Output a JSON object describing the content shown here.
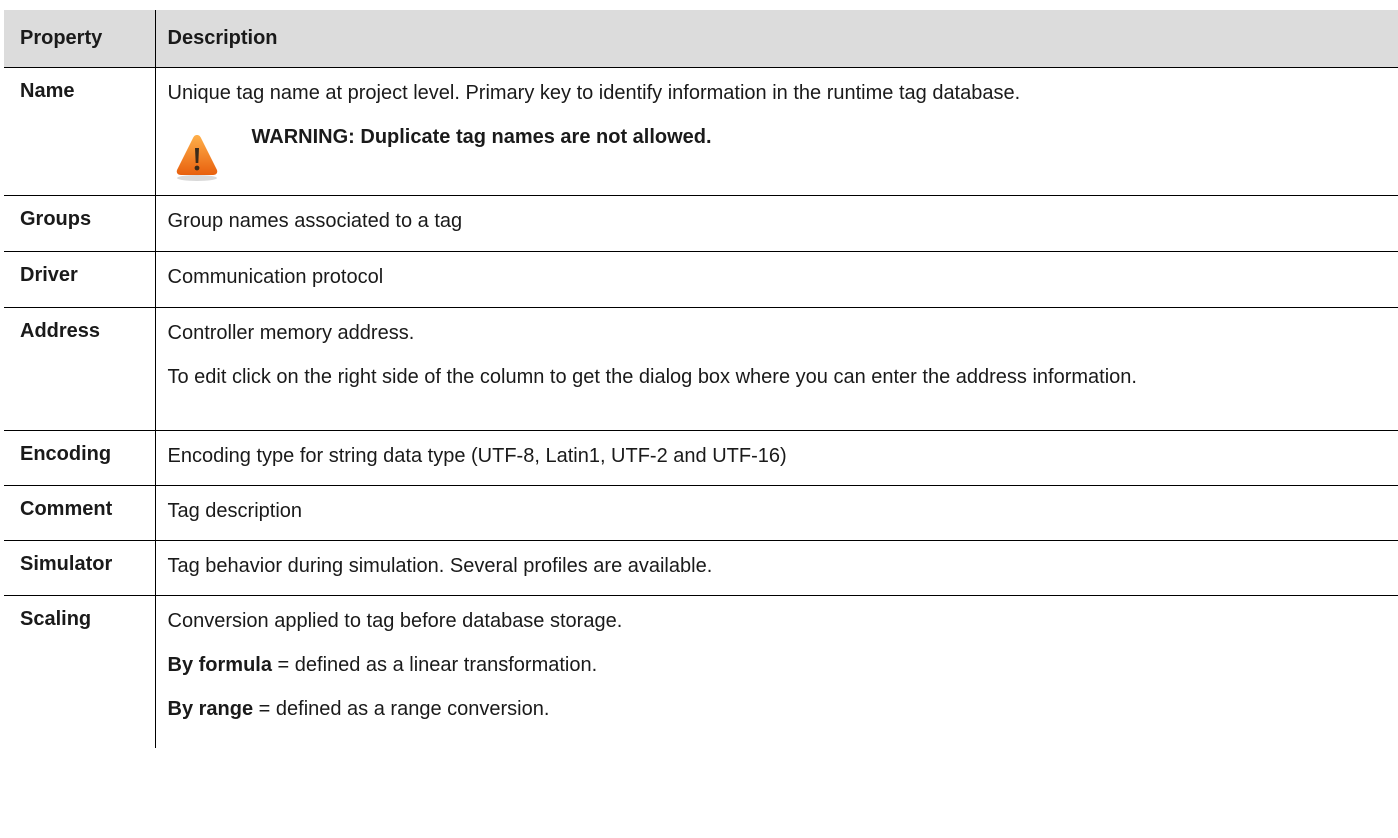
{
  "table": {
    "headers": {
      "property": "Property",
      "description": "Description"
    },
    "rows": [
      {
        "property": "Name",
        "lines": [
          "Unique tag name at project level. Primary key to identify information in the runtime tag database."
        ],
        "warning": {
          "icon": "warning-icon",
          "text": "WARNING: Duplicate tag names are not allowed."
        }
      },
      {
        "property": "Groups",
        "lines": [
          "Group names associated to a tag"
        ]
      },
      {
        "property": "Driver",
        "lines": [
          "Communication protocol"
        ]
      },
      {
        "property": "Address",
        "lines": [
          "Controller memory address.",
          "To edit click on the right side of the column to get the dialog box where you can enter the address information."
        ]
      },
      {
        "property": "Encoding",
        "lines": [
          "Encoding type for string data type (UTF-8, Latin1, UTF-2 and UTF-16)"
        ]
      },
      {
        "property": "Comment",
        "lines": [
          "Tag description"
        ]
      },
      {
        "property": "Simulator",
        "lines": [
          "Tag behavior during simulation. Several profiles are available."
        ]
      },
      {
        "property": "Scaling",
        "lines": [
          "Conversion applied to tag before database storage."
        ],
        "options": [
          {
            "term": "By formula",
            "desc": " = defined as a linear transformation."
          },
          {
            "term": "By range",
            "desc": " = defined as a range conversion."
          }
        ]
      }
    ]
  },
  "colors": {
    "header_bg": "#dcdcdc",
    "warning_orange": "#f07a1a"
  }
}
